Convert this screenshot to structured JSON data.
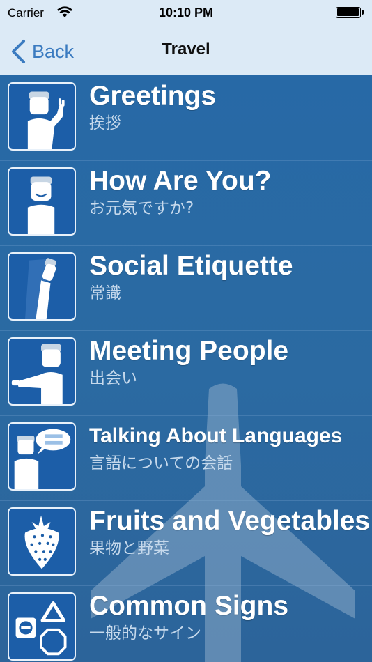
{
  "status": {
    "carrier": "Carrier",
    "time": "10:10 PM"
  },
  "nav": {
    "back_label": "Back",
    "title": "Travel"
  },
  "rows": [
    {
      "title": "Greetings",
      "subtitle": "挨拶",
      "icon": "waving-person-icon"
    },
    {
      "title": "How Are You?",
      "subtitle": "お元気ですか?",
      "icon": "smiling-person-icon"
    },
    {
      "title": "Social Etiquette",
      "subtitle": "常識",
      "icon": "bowing-person-icon"
    },
    {
      "title": "Meeting People",
      "subtitle": "出会い",
      "icon": "handshake-person-icon"
    },
    {
      "title": "Talking About Languages",
      "subtitle": "言語についての会話",
      "icon": "speech-flag-person-icon"
    },
    {
      "title": "Fruits and Vegetables",
      "subtitle": "果物と野菜",
      "icon": "strawberry-icon"
    },
    {
      "title": "Common Signs",
      "subtitle": "一般的なサイン",
      "icon": "road-signs-icon"
    }
  ],
  "colors": {
    "nav_background": "#dceaf6",
    "accent": "#3b7bc0",
    "list_background": "#2a6aa6",
    "tile_background": "#1c5ea8"
  }
}
